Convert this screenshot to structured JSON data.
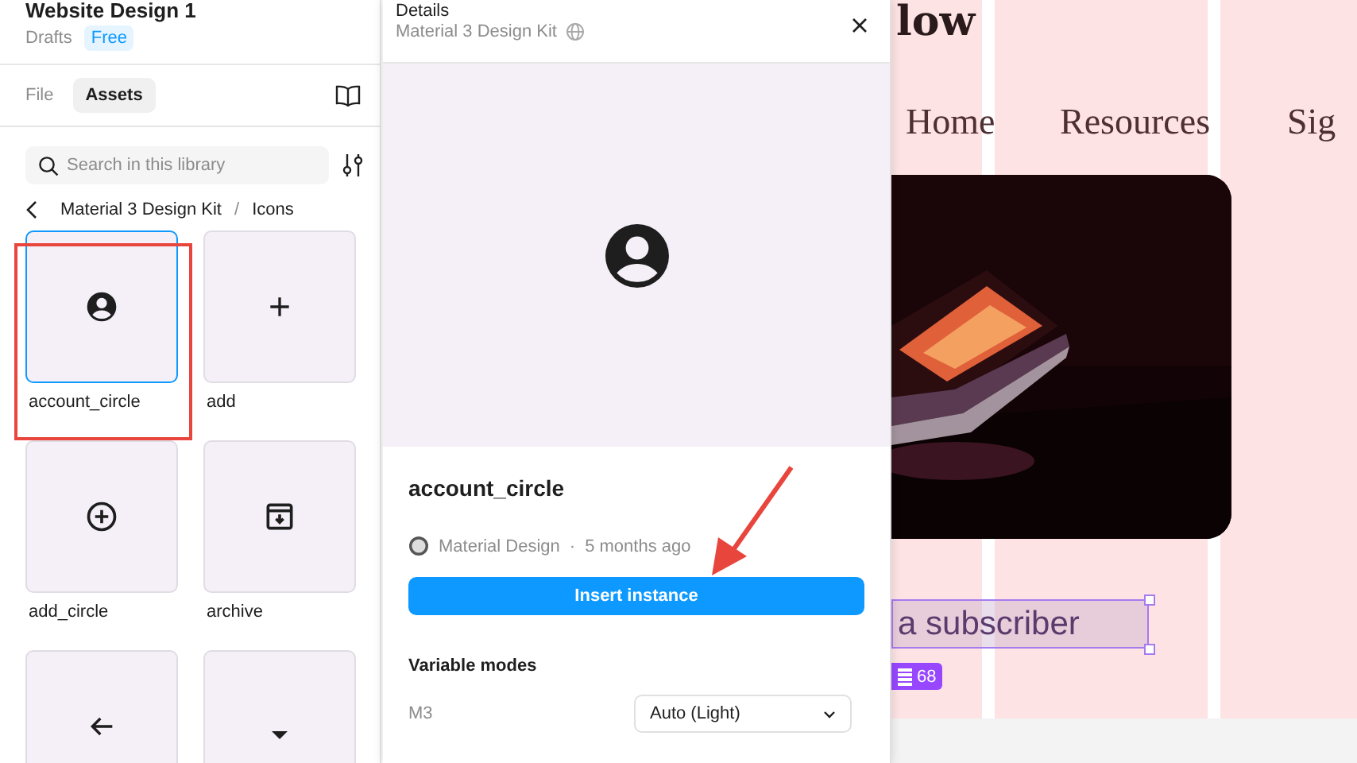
{
  "file": {
    "title": "Website Design 1",
    "location": "Drafts",
    "plan": "Free"
  },
  "tabs": [
    {
      "label": "File",
      "selected": false
    },
    {
      "label": "Assets",
      "selected": true
    }
  ],
  "search": {
    "placeholder": "Search in this library"
  },
  "breadcrumb": [
    "Material 3 Design Kit",
    "/",
    "Icons"
  ],
  "assets": [
    {
      "name": "account_circle",
      "kind": "account",
      "selected": true
    },
    {
      "name": "add",
      "kind": "plus",
      "selected": false
    },
    {
      "name": "add_circle",
      "kind": "plus_circle",
      "selected": false
    },
    {
      "name": "archive",
      "kind": "archive",
      "selected": false
    },
    {
      "kind": "arrow_back",
      "selected": false
    },
    {
      "kind": "triangle_down",
      "selected": false
    }
  ],
  "details": {
    "title": "Details",
    "library": "Material 3 Design Kit",
    "component": "account_circle",
    "author": "Material Design",
    "dot": "·",
    "updated": "5 months ago",
    "action": "Insert instance",
    "section": "Variable modes",
    "modes": [
      {
        "collection": "M3",
        "value": "Auto (Light)"
      }
    ]
  },
  "canvas": {
    "heading": "low",
    "nav": [
      "Home",
      "Resources",
      "Sig"
    ],
    "text": "a subscriber",
    "badge": "68"
  }
}
